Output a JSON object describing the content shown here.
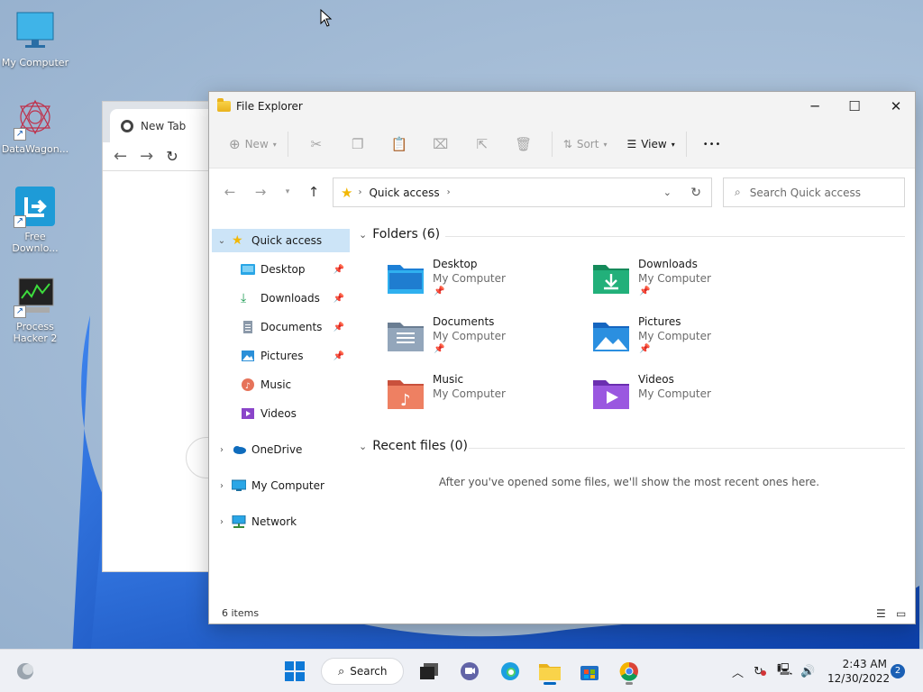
{
  "desktop": {
    "icons": [
      {
        "label": "My Computer"
      },
      {
        "label": "DataWagon..."
      },
      {
        "label": "Free Downlo..."
      },
      {
        "label": "Process Hacker 2"
      }
    ]
  },
  "chrome": {
    "tab_title": "New Tab"
  },
  "explorer": {
    "title": "File Explorer",
    "toolbar": {
      "new_label": "New",
      "sort_label": "Sort",
      "view_label": "View",
      "more_label": "•••"
    },
    "address": {
      "crumb": "Quick access"
    },
    "search": {
      "placeholder": "Search Quick access"
    },
    "sidebar": {
      "items": [
        {
          "label": "Quick access"
        },
        {
          "label": "Desktop"
        },
        {
          "label": "Downloads"
        },
        {
          "label": "Documents"
        },
        {
          "label": "Pictures"
        },
        {
          "label": "Music"
        },
        {
          "label": "Videos"
        },
        {
          "label": "OneDrive"
        },
        {
          "label": "My Computer"
        },
        {
          "label": "Network"
        }
      ]
    },
    "folders_header": "Folders (6)",
    "folders": [
      {
        "name": "Desktop",
        "location": "My Computer"
      },
      {
        "name": "Downloads",
        "location": "My Computer"
      },
      {
        "name": "Documents",
        "location": "My Computer"
      },
      {
        "name": "Pictures",
        "location": "My Computer"
      },
      {
        "name": "Music",
        "location": "My Computer"
      },
      {
        "name": "Videos",
        "location": "My Computer"
      }
    ],
    "recent_header": "Recent files (0)",
    "recent_empty": "After you've opened some files, we'll show the most recent ones here.",
    "status": "6 items"
  },
  "taskbar": {
    "search_label": "Search",
    "time": "2:43 AM",
    "date": "12/30/2022",
    "notifications": "2"
  },
  "colors": {
    "accent": "#0067c0",
    "selection": "#cce4f7",
    "wallpaper_blue": "#1c58d6"
  }
}
